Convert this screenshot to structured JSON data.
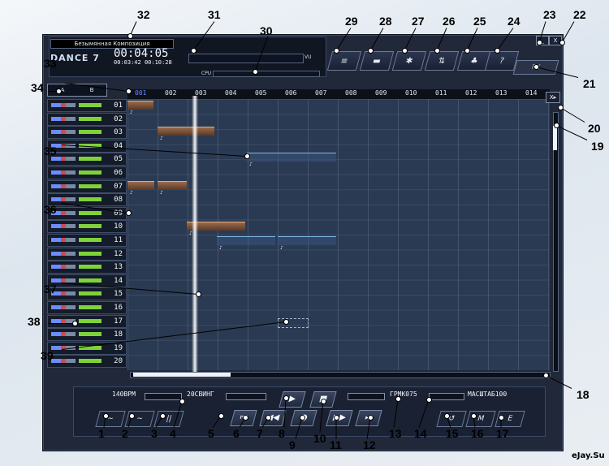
{
  "app": {
    "song_title": "Безымянная Композиция",
    "logo": "DANCE 7",
    "time_main": "00:04:05",
    "time_sub_left": "00:03:42",
    "time_sub_right": "00:10:28",
    "vu_label": "VU",
    "cpu_label": "CPU"
  },
  "toolbar": {
    "buttons": [
      "list",
      "folder",
      "effects",
      "mixer",
      "samples",
      "help"
    ],
    "fx_button": "FX"
  },
  "window": {
    "minimize": "_",
    "close": "X"
  },
  "track_toggle": {
    "left": "A",
    "right": "B"
  },
  "ruler": [
    "001",
    "002",
    "003",
    "004",
    "005",
    "006",
    "007",
    "008",
    "009",
    "010",
    "011",
    "012",
    "013",
    "014"
  ],
  "tracks": [
    "01",
    "02",
    "03",
    "04",
    "05",
    "06",
    "07",
    "08",
    "09",
    "10",
    "11",
    "12",
    "13",
    "14",
    "15",
    "16",
    "17",
    "18",
    "19",
    "20"
  ],
  "bottom": {
    "bpm": "140BPM",
    "swing": "20СВИНГ",
    "rpm": "ГРМК075",
    "scale": "МАСШТАБ100"
  },
  "transport": {
    "play": "▶",
    "stop": "■",
    "rewind_start": "⏮",
    "rewind": "◀◀",
    "record": "●",
    "forward": "▶▶",
    "forward_end": "⏭"
  },
  "modes": [
    "~",
    "~",
    "||",
    "↺",
    "M",
    "E"
  ],
  "callouts": [
    "1",
    "2",
    "3",
    "4",
    "5",
    "6",
    "7",
    "8",
    "9",
    "10",
    "11",
    "12",
    "13",
    "14",
    "15",
    "16",
    "17",
    "18",
    "19",
    "20",
    "21",
    "22",
    "23",
    "24",
    "25",
    "26",
    "27",
    "28",
    "29",
    "30",
    "31",
    "32",
    "33",
    "34",
    "35",
    "36",
    "37",
    "38",
    "39"
  ],
  "watermark": "eJay.Su"
}
